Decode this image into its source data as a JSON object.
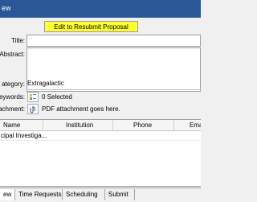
{
  "window": {
    "title": "ew"
  },
  "toolbar": {
    "resubmit_label": "Edit to Resubmit Proposal"
  },
  "form": {
    "title_label": "Title:",
    "abstract_label": "Abstract:",
    "category_label": "ategory:",
    "category_value": "Extragalactic",
    "keywords_label": "eywords:",
    "keywords_value": "0 Selected",
    "attachment_label": "ttachment:",
    "attachment_value": "PDF attachment goes here."
  },
  "investigators_table": {
    "columns": [
      "Name",
      "Institution",
      "Phone",
      "Ema"
    ],
    "rows": [
      [
        "cipal Investiga...",
        "",
        "",
        ""
      ]
    ]
  },
  "tabs": [
    {
      "label": "ew",
      "active": true
    },
    {
      "label": "Time Requests",
      "active": false
    },
    {
      "label": "Scheduling",
      "active": false
    },
    {
      "label": "Submit",
      "active": false
    }
  ],
  "colors": {
    "titlebar": "#2b5797",
    "resubmit_button": "#ffff33"
  },
  "icons": {
    "keywords": "keywords-icon",
    "attachment": "attachment-icon",
    "move_up": "arrow-up-icon",
    "move_down": "arrow-down-icon"
  }
}
